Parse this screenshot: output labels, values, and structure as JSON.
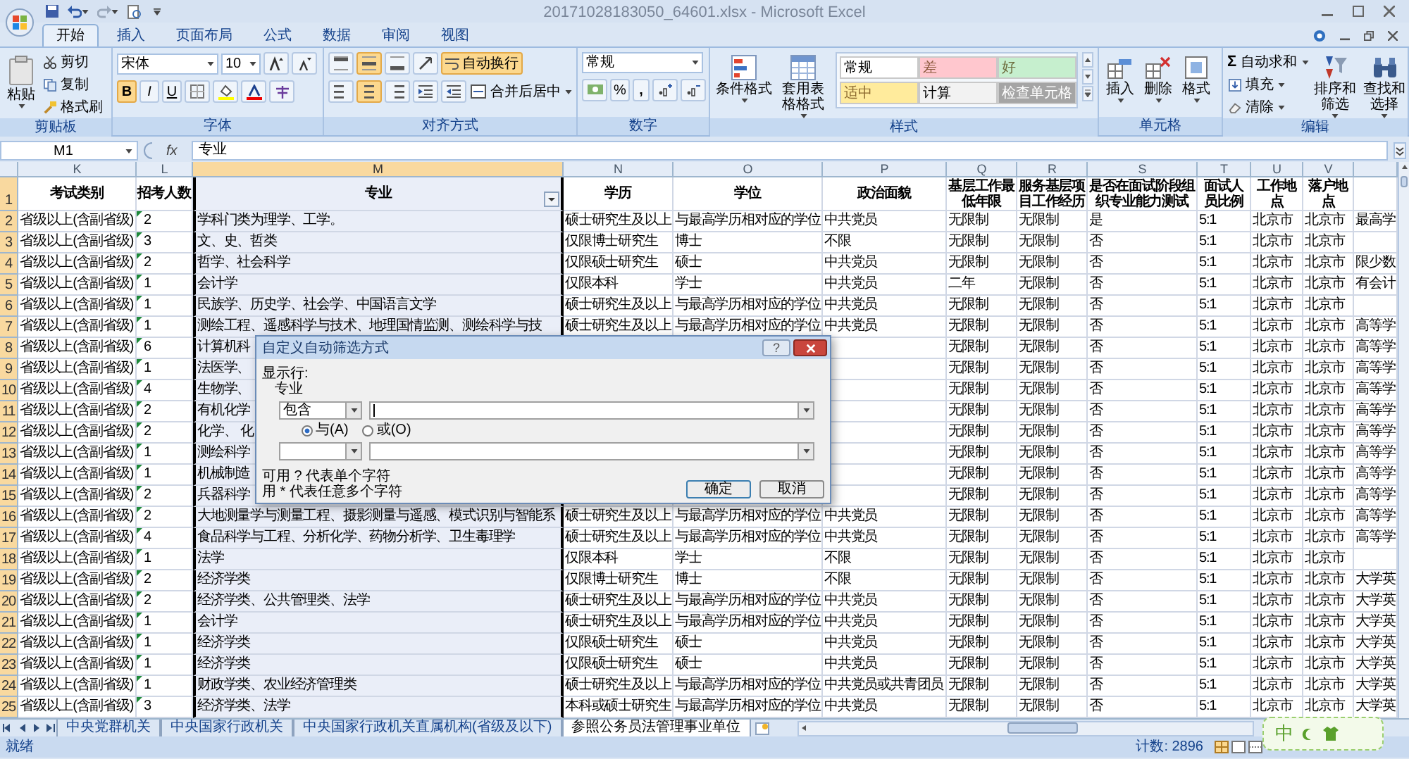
{
  "window": {
    "title": "20171028183050_64601.xlsx - Microsoft Excel"
  },
  "ribbon": {
    "tabs": [
      {
        "label": "开始",
        "selected": true
      },
      {
        "label": "插入",
        "selected": false
      },
      {
        "label": "页面布局",
        "selected": false
      },
      {
        "label": "公式",
        "selected": false
      },
      {
        "label": "数据",
        "selected": false
      },
      {
        "label": "审阅",
        "selected": false
      },
      {
        "label": "视图",
        "selected": false
      }
    ],
    "clipboard": {
      "title": "剪贴板",
      "paste": "粘贴",
      "cut": "剪切",
      "copy": "复制",
      "painter": "格式刷"
    },
    "font": {
      "title": "字体",
      "name": "宋体",
      "size": "10",
      "styles": [
        {
          "label": "B",
          "selected": true
        },
        {
          "label": "I",
          "selected": false
        },
        {
          "label": "U",
          "selected": false
        }
      ]
    },
    "alignment": {
      "title": "对齐方式",
      "vertical": [
        {
          "selected": false
        },
        {
          "selected": true
        },
        {
          "selected": false
        }
      ],
      "horizontal": [
        {
          "selected": false
        },
        {
          "selected": true
        },
        {
          "selected": false
        }
      ],
      "wrap": {
        "label": "自动换行",
        "on": true
      },
      "merge": "合并后居中"
    },
    "number": {
      "title": "数字",
      "format": "常规",
      "percent": "%",
      "comma": ","
    },
    "styles": {
      "title": "样式",
      "conditional": "条件格式",
      "table": "套用表格格式",
      "gallery": [
        {
          "label": "常规",
          "color": "#ffffff"
        },
        {
          "label": "差",
          "color": "#ffc7ce"
        },
        {
          "label": "好",
          "color": "#c6efce"
        },
        {
          "label": "适中",
          "color": "#ffeb9c"
        },
        {
          "label": "计算",
          "color": "#f2f2f2"
        },
        {
          "label": "检查单元格",
          "color": "#a5a5a5"
        }
      ]
    },
    "cells": {
      "title": "单元格",
      "buttons": [
        "插入",
        "删除",
        "格式"
      ]
    },
    "editing": {
      "title": "编辑",
      "sum_symbol": "Σ",
      "sum": "自动求和",
      "fill": "填充",
      "clear": "清除",
      "sort": "排序和筛选",
      "find": "查找和选择"
    }
  },
  "formula_bar": {
    "name_box": "M1",
    "function_label": "fx",
    "value": "专业"
  },
  "grid": {
    "columns": [
      {
        "letter": "K",
        "selected": false
      },
      {
        "letter": "L",
        "selected": false,
        "error_flags": true
      },
      {
        "letter": "M",
        "selected": true,
        "filter_button": true
      },
      {
        "letter": "N",
        "selected": false
      },
      {
        "letter": "O",
        "selected": false
      },
      {
        "letter": "P",
        "selected": false
      },
      {
        "letter": "Q",
        "selected": false
      },
      {
        "letter": "R",
        "selected": false
      },
      {
        "letter": "S",
        "selected": false
      },
      {
        "letter": "T",
        "selected": false
      },
      {
        "letter": "U",
        "selected": false
      },
      {
        "letter": "V",
        "selected": false
      },
      {
        "selected": false
      }
    ],
    "header": {
      "number": "1",
      "cells": [
        "考试类别",
        "招考人数",
        "专业",
        "学历",
        "学位",
        "政治面貌",
        "基层工作最低年限",
        "服务基层项目工作经历",
        "是否在面试阶段组织专业能力测试",
        "面试人员比例",
        "工作地点",
        "落户地点",
        null
      ]
    },
    "rows": [
      {
        "number": "2",
        "cells": [
          "省级以上(含副省级)",
          "2",
          "学科门类为理学、工学。",
          "硕士研究生及以上",
          "与最高学历相对应的学位",
          "中共党员",
          "无限制",
          "无限制",
          "是",
          "5:1",
          "北京市",
          "北京市",
          "最高学"
        ]
      },
      {
        "number": "3",
        "cells": [
          "省级以上(含副省级)",
          "3",
          "文、史、哲类",
          "仅限博士研究生",
          "博士",
          "不限",
          "无限制",
          "无限制",
          "否",
          "5:1",
          "北京市",
          "北京市",
          null
        ]
      },
      {
        "number": "4",
        "cells": [
          "省级以上(含副省级)",
          "2",
          "哲学、社会科学",
          "仅限硕士研究生",
          "硕士",
          "中共党员",
          "无限制",
          "无限制",
          "否",
          "5:1",
          "北京市",
          "北京市",
          "限少数"
        ]
      },
      {
        "number": "5",
        "cells": [
          "省级以上(含副省级)",
          "1",
          "会计学",
          "仅限本科",
          "学士",
          "中共党员",
          "二年",
          "无限制",
          "否",
          "5:1",
          "北京市",
          "北京市",
          "有会计"
        ]
      },
      {
        "number": "6",
        "cells": [
          "省级以上(含副省级)",
          "1",
          "民族学、历史学、社会学、中国语言文学",
          "硕士研究生及以上",
          "与最高学历相对应的学位",
          "中共党员",
          "无限制",
          "无限制",
          "否",
          "5:1",
          "北京市",
          "北京市",
          null
        ]
      },
      {
        "number": "7",
        "cells": [
          "省级以上(含副省级)",
          "1",
          "测绘工程、遥感科学与技术、地理国情监测、测绘科学与技",
          "硕士研究生及以上",
          "与最高学历相对应的学位",
          "中共党员",
          "无限制",
          "无限制",
          "否",
          "5:1",
          "北京市",
          "北京市",
          "高等学"
        ]
      },
      {
        "number": "8",
        "cells": [
          "省级以上(含副省级)",
          "6",
          "计算机科",
          null,
          null,
          null,
          "无限制",
          "无限制",
          "否",
          "5:1",
          "北京市",
          "北京市",
          "高等学"
        ]
      },
      {
        "number": "9",
        "cells": [
          "省级以上(含副省级)",
          "1",
          "法医学、",
          null,
          null,
          null,
          "无限制",
          "无限制",
          "否",
          "5:1",
          "北京市",
          "北京市",
          "高等学"
        ]
      },
      {
        "number": "10",
        "cells": [
          "省级以上(含副省级)",
          "4",
          "生物学、",
          null,
          null,
          null,
          "无限制",
          "无限制",
          "否",
          "5:1",
          "北京市",
          "北京市",
          "高等学"
        ]
      },
      {
        "number": "11",
        "cells": [
          "省级以上(含副省级)",
          "2",
          "有机化学",
          null,
          null,
          null,
          "无限制",
          "无限制",
          "否",
          "5:1",
          "北京市",
          "北京市",
          "高等学"
        ]
      },
      {
        "number": "12",
        "cells": [
          "省级以上(含副省级)",
          "2",
          "化学、 化",
          null,
          null,
          null,
          "无限制",
          "无限制",
          "否",
          "5:1",
          "北京市",
          "北京市",
          "高等学"
        ]
      },
      {
        "number": "13",
        "cells": [
          "省级以上(含副省级)",
          "1",
          "测绘科学",
          null,
          null,
          null,
          "无限制",
          "无限制",
          "否",
          "5:1",
          "北京市",
          "北京市",
          "高等学"
        ]
      },
      {
        "number": "14",
        "cells": [
          "省级以上(含副省级)",
          "1",
          "机械制造",
          null,
          null,
          null,
          "无限制",
          "无限制",
          "否",
          "5:1",
          "北京市",
          "北京市",
          "高等学"
        ]
      },
      {
        "number": "15",
        "cells": [
          "省级以上(含副省级)",
          "2",
          "兵器科学",
          null,
          null,
          null,
          "无限制",
          "无限制",
          "否",
          "5:1",
          "北京市",
          "北京市",
          "高等学"
        ]
      },
      {
        "number": "16",
        "cells": [
          "省级以上(含副省级)",
          "2",
          "大地测量学与测量工程、摄影测量与遥感、模式识别与智能系",
          "硕士研究生及以上",
          "与最高学历相对应的学位",
          "中共党员",
          "无限制",
          "无限制",
          "否",
          "5:1",
          "北京市",
          "北京市",
          "高等学"
        ]
      },
      {
        "number": "17",
        "cells": [
          "省级以上(含副省级)",
          "4",
          "食品科学与工程、分析化学、药物分析学、卫生毒理学",
          "硕士研究生及以上",
          "与最高学历相对应的学位",
          "中共党员",
          "无限制",
          "无限制",
          "否",
          "5:1",
          "北京市",
          "北京市",
          "高等学"
        ]
      },
      {
        "number": "18",
        "cells": [
          "省级以上(含副省级)",
          "1",
          "法学",
          "仅限本科",
          "学士",
          "不限",
          "无限制",
          "无限制",
          "否",
          "5:1",
          "北京市",
          "北京市",
          null
        ]
      },
      {
        "number": "19",
        "cells": [
          "省级以上(含副省级)",
          "2",
          "经济学类",
          "仅限博士研究生",
          "博士",
          "不限",
          "无限制",
          "无限制",
          "否",
          "5:1",
          "北京市",
          "北京市",
          "大学英"
        ]
      },
      {
        "number": "20",
        "cells": [
          "省级以上(含副省级)",
          "2",
          "经济学类、公共管理类、法学",
          "硕士研究生及以上",
          "与最高学历相对应的学位",
          "中共党员",
          "无限制",
          "无限制",
          "否",
          "5:1",
          "北京市",
          "北京市",
          "大学英"
        ]
      },
      {
        "number": "21",
        "cells": [
          "省级以上(含副省级)",
          "1",
          "会计学",
          "硕士研究生及以上",
          "与最高学历相对应的学位",
          "中共党员",
          "无限制",
          "无限制",
          "否",
          "5:1",
          "北京市",
          "北京市",
          "大学英"
        ]
      },
      {
        "number": "22",
        "cells": [
          "省级以上(含副省级)",
          "1",
          "经济学类",
          "仅限硕士研究生",
          "硕士",
          "中共党员",
          "无限制",
          "无限制",
          "否",
          "5:1",
          "北京市",
          "北京市",
          "大学英"
        ]
      },
      {
        "number": "23",
        "cells": [
          "省级以上(含副省级)",
          "1",
          "经济学类",
          "仅限硕士研究生",
          "硕士",
          "中共党员",
          "无限制",
          "无限制",
          "否",
          "5:1",
          "北京市",
          "北京市",
          "大学英"
        ]
      },
      {
        "number": "24",
        "cells": [
          "省级以上(含副省级)",
          "1",
          "财政学类、农业经济管理类",
          "硕士研究生及以上",
          "与最高学历相对应的学位",
          "中共党员或共青团员",
          "无限制",
          "无限制",
          "否",
          "5:1",
          "北京市",
          "北京市",
          "大学英"
        ]
      },
      {
        "number": "25",
        "cells": [
          "省级以上(含副省级)",
          "3",
          "经济学类、法学",
          "本科或硕士研究生",
          "与最高学历相对应的学位",
          "中共党员",
          "无限制",
          "无限制",
          "否",
          "5:1",
          "北京市",
          "北京市",
          "大学英"
        ]
      }
    ]
  },
  "dialog": {
    "title": "自定义自动筛选方式",
    "help": "?",
    "show_rows_label": "显示行:",
    "field_name": "专业",
    "conditions": [
      {
        "operator": "包含",
        "focused": true
      },
      {
        "focused": false
      }
    ],
    "logic": [
      {
        "label": "与(A)",
        "selected": true
      },
      {
        "label": "或(O)",
        "selected": false
      }
    ],
    "hints": [
      "可用 ? 代表单个字符",
      "用 * 代表任意多个字符"
    ],
    "buttons": [
      {
        "label": "确定",
        "default": true
      },
      {
        "label": "取消",
        "default": false
      }
    ]
  },
  "sheet_tabs": [
    {
      "label": "中央党群机关",
      "selected": false
    },
    {
      "label": "中央国家行政机关",
      "selected": false
    },
    {
      "label": "中央国家行政机关直属机构(省级及以下)",
      "selected": false
    },
    {
      "label": "参照公务员法管理事业单位",
      "selected": true
    }
  ],
  "status_bar": {
    "mode": "就绪",
    "count": "计数: 2896"
  },
  "ime": {
    "label": "中"
  }
}
